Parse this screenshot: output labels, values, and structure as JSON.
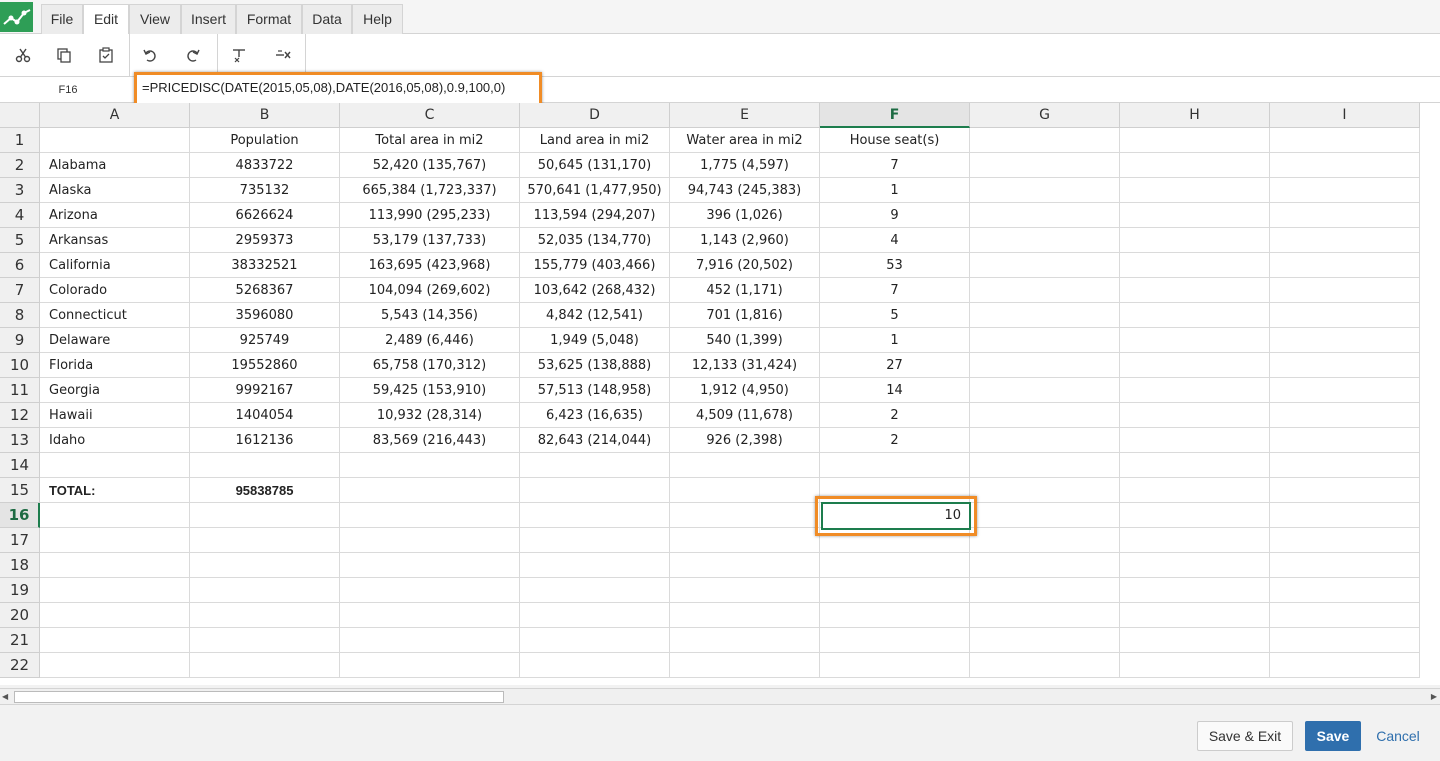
{
  "menu": {
    "items": [
      "File",
      "Edit",
      "View",
      "Insert",
      "Format",
      "Data",
      "Help"
    ],
    "active": "Edit"
  },
  "toolbar": {
    "icons": [
      "cut-icon",
      "copy-icon",
      "paste-icon",
      "undo-icon",
      "redo-icon",
      "clear-format-icon",
      "clear-content-icon"
    ]
  },
  "formula_bar": {
    "cell_ref": "F16",
    "formula": "=PRICEDISC(DATE(2015,05,08),DATE(2016,05,08),0.9,100,0)"
  },
  "sheet": {
    "columns": [
      "A",
      "B",
      "C",
      "D",
      "E",
      "F",
      "G",
      "H",
      "I"
    ],
    "selected_column": "F",
    "selected_row": 16,
    "row_numbers": [
      1,
      2,
      3,
      4,
      5,
      6,
      7,
      8,
      9,
      10,
      11,
      12,
      13,
      14,
      15,
      16,
      17,
      18,
      19,
      20,
      21,
      22
    ],
    "header_row": [
      "",
      "Population",
      "Total area in mi2",
      "Land area in mi2",
      "Water area in mi2",
      "House seat(s)"
    ],
    "rows": [
      [
        "Alabama",
        "4833722",
        "52,420 (135,767)",
        "50,645 (131,170)",
        "1,775 (4,597)",
        "7"
      ],
      [
        "Alaska",
        "735132",
        "665,384 (1,723,337)",
        "570,641 (1,477,950)",
        "94,743 (245,383)",
        "1"
      ],
      [
        "Arizona",
        "6626624",
        "113,990 (295,233)",
        "113,594 (294,207)",
        "396 (1,026)",
        "9"
      ],
      [
        "Arkansas",
        "2959373",
        "53,179 (137,733)",
        "52,035 (134,770)",
        "1,143 (2,960)",
        "4"
      ],
      [
        "California",
        "38332521",
        "163,695 (423,968)",
        "155,779 (403,466)",
        "7,916 (20,502)",
        "53"
      ],
      [
        "Colorado",
        "5268367",
        "104,094 (269,602)",
        "103,642 (268,432)",
        "452 (1,171)",
        "7"
      ],
      [
        "Connecticut",
        "3596080",
        "5,543 (14,356)",
        "4,842 (12,541)",
        "701 (1,816)",
        "5"
      ],
      [
        "Delaware",
        "925749",
        "2,489 (6,446)",
        "1,949 (5,048)",
        "540 (1,399)",
        "1"
      ],
      [
        "Florida",
        "19552860",
        "65,758 (170,312)",
        "53,625 (138,888)",
        "12,133 (31,424)",
        "27"
      ],
      [
        "Georgia",
        "9992167",
        "59,425 (153,910)",
        "57,513 (148,958)",
        "1,912 (4,950)",
        "14"
      ],
      [
        "Hawaii",
        "1404054",
        "10,932 (28,314)",
        "6,423 (16,635)",
        "4,509 (11,678)",
        "2"
      ],
      [
        "Idaho",
        "1612136",
        "83,569 (216,443)",
        "82,643 (214,044)",
        "926 (2,398)",
        "2"
      ]
    ],
    "total_label": "TOTAL:",
    "total_value": "95838785",
    "active_cell_value": "10"
  },
  "footer": {
    "save_exit_label": "Save & Exit",
    "save_label": "Save",
    "cancel_label": "Cancel"
  }
}
